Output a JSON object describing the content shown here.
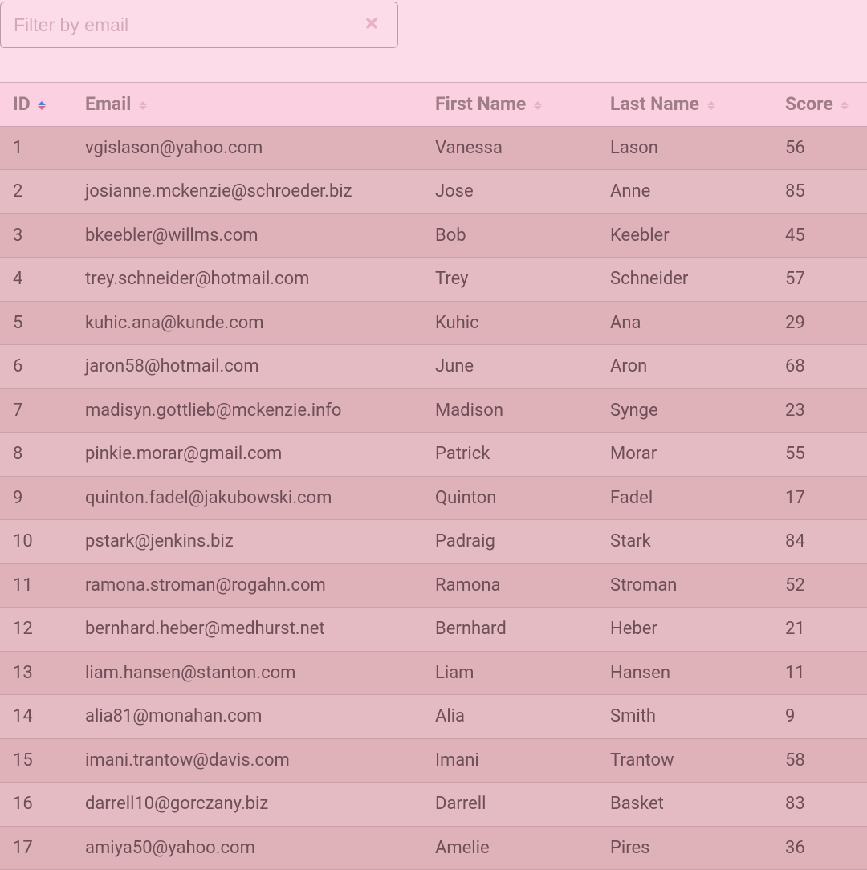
{
  "filter": {
    "placeholder": "Filter by email",
    "value": ""
  },
  "columns": {
    "id": "ID",
    "email": "Email",
    "first_name": "First Name",
    "last_name": "Last Name",
    "score": "Score"
  },
  "sort": {
    "column": "id",
    "direction": "asc"
  },
  "rows": [
    {
      "id": "1",
      "email": "vgislason@yahoo.com",
      "first_name": "Vanessa",
      "last_name": "Lason",
      "score": "56"
    },
    {
      "id": "2",
      "email": "josianne.mckenzie@schroeder.biz",
      "first_name": "Jose",
      "last_name": "Anne",
      "score": "85"
    },
    {
      "id": "3",
      "email": "bkeebler@willms.com",
      "first_name": "Bob",
      "last_name": "Keebler",
      "score": "45"
    },
    {
      "id": "4",
      "email": "trey.schneider@hotmail.com",
      "first_name": "Trey",
      "last_name": "Schneider",
      "score": "57"
    },
    {
      "id": "5",
      "email": "kuhic.ana@kunde.com",
      "first_name": "Kuhic",
      "last_name": "Ana",
      "score": "29"
    },
    {
      "id": "6",
      "email": "jaron58@hotmail.com",
      "first_name": "June",
      "last_name": "Aron",
      "score": "68"
    },
    {
      "id": "7",
      "email": "madisyn.gottlieb@mckenzie.info",
      "first_name": "Madison",
      "last_name": "Synge",
      "score": "23"
    },
    {
      "id": "8",
      "email": "pinkie.morar@gmail.com",
      "first_name": "Patrick",
      "last_name": "Morar",
      "score": "55"
    },
    {
      "id": "9",
      "email": "quinton.fadel@jakubowski.com",
      "first_name": "Quinton",
      "last_name": "Fadel",
      "score": "17"
    },
    {
      "id": "10",
      "email": "pstark@jenkins.biz",
      "first_name": "Padraig",
      "last_name": "Stark",
      "score": "84"
    },
    {
      "id": "11",
      "email": "ramona.stroman@rogahn.com",
      "first_name": "Ramona",
      "last_name": "Stroman",
      "score": "52"
    },
    {
      "id": "12",
      "email": "bernhard.heber@medhurst.net",
      "first_name": "Bernhard",
      "last_name": "Heber",
      "score": "21"
    },
    {
      "id": "13",
      "email": "liam.hansen@stanton.com",
      "first_name": "Liam",
      "last_name": "Hansen",
      "score": "11"
    },
    {
      "id": "14",
      "email": "alia81@monahan.com",
      "first_name": "Alia",
      "last_name": "Smith",
      "score": "9"
    },
    {
      "id": "15",
      "email": "imani.trantow@davis.com",
      "first_name": "Imani",
      "last_name": "Trantow",
      "score": "58"
    },
    {
      "id": "16",
      "email": "darrell10@gorczany.biz",
      "first_name": "Darrell",
      "last_name": "Basket",
      "score": "83"
    },
    {
      "id": "17",
      "email": "amiya50@yahoo.com",
      "first_name": "Amelie",
      "last_name": "Pires",
      "score": "36"
    }
  ]
}
